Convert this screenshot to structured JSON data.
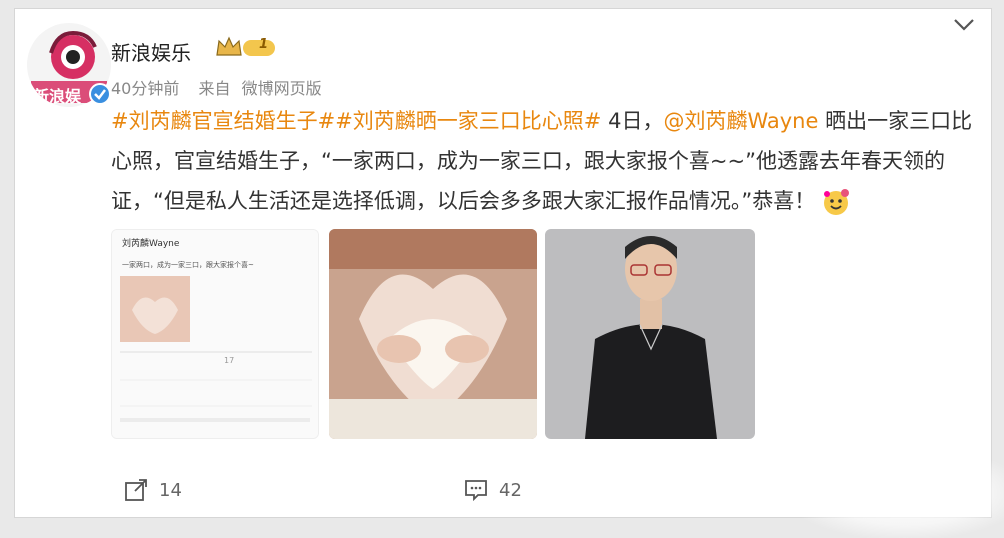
{
  "post": {
    "author": "新浪娱乐",
    "vip_level": "1",
    "time": "40分钟前",
    "source_prefix": "来自",
    "source": "微博网页版",
    "avatar_text": "新浪娱",
    "hashtag1": "#刘芮麟官宣结婚生子#",
    "hashtag2": "#刘芮麟晒一家三口比心照#",
    "text_a": " 4日，",
    "mention": "@刘芮麟Wayne",
    "text_b": " 晒出一家三口比心照，官宣结婚生子，“一家两口，成为一家三口，跟大家报个喜~~”他透露去年春天领的证，“但是私人生活还是选择低调，以后会多多跟大家汇报作品情况。”恭喜！",
    "emoji": "congrats-emoji"
  },
  "thumb": {
    "title": "刘芮麟Wayne",
    "line1": "一家两口，成为一家三口，跟大家报个喜~",
    "count": "17"
  },
  "actions": {
    "forward_count": "14",
    "comment_count": "42"
  },
  "colors": {
    "tag": "#e8870f",
    "accent_blue": "#3a8fe0"
  }
}
